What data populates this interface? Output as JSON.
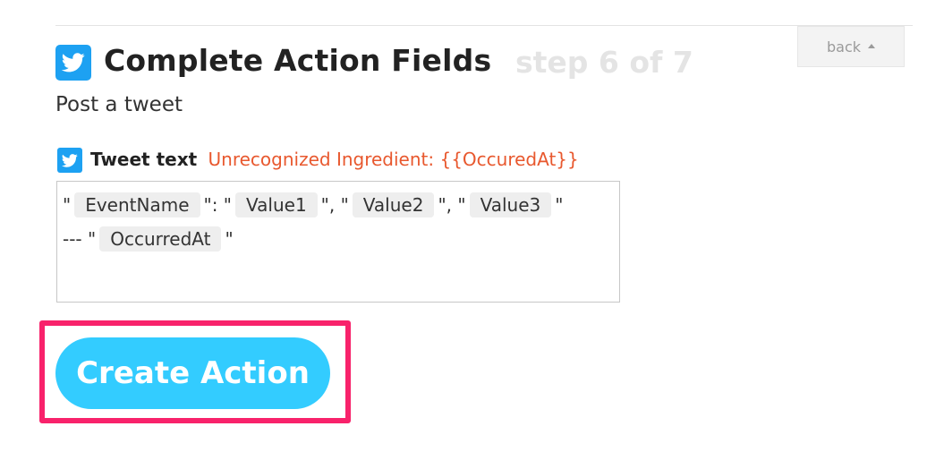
{
  "nav": {
    "back_label": "back"
  },
  "header": {
    "title": "Complete Action Fields",
    "step": "step 6 of 7"
  },
  "action": {
    "subtitle": "Post a tweet"
  },
  "field": {
    "label": "Tweet text",
    "error": "Unrecognized Ingredient: {{OccuredAt}}"
  },
  "tweet": {
    "line1": {
      "q1": "\"",
      "ing1": "EventName",
      "sep1": "\": \"",
      "ing2": "Value1",
      "sep2": "\", \"",
      "ing3": "Value2",
      "sep3": "\", \"",
      "ing4": "Value3",
      "q2": "\""
    },
    "line2": {
      "prefix": "--- \"",
      "ing1": "OccurredAt",
      "q2": "\""
    }
  },
  "submit": {
    "label": "Create Action"
  },
  "colors": {
    "accent": "#33ccff",
    "twitter": "#1da1f2",
    "error": "#e8582e",
    "highlight": "#f8226b"
  },
  "icons": {
    "header": "twitter-icon",
    "field": "twitter-icon",
    "back": "caret-up-icon"
  }
}
